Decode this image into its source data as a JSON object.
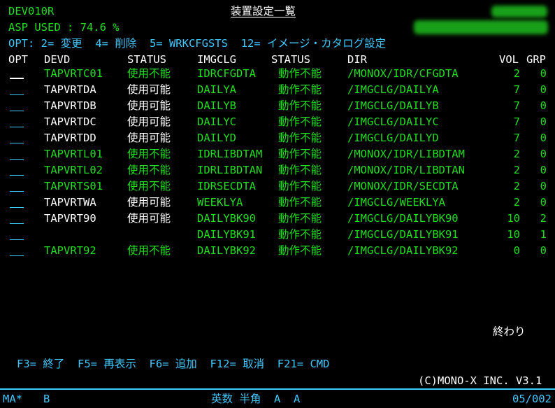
{
  "header": {
    "program_id": "DEV010R",
    "title": "装置設定一覧",
    "asp_used": "ASP USED : 74.6 %",
    "options": "OPT: 2= 変更  4= 削除  5= WRKCFGSTS  12= イメージ・カタログ設定"
  },
  "columns": {
    "opt": "OPT",
    "devd": "DEVD",
    "status": "STATUS",
    "imgclg": "IMGCLG",
    "status2": "STATUS",
    "dir": "DIR",
    "vol": "VOL",
    "grp": "GRP"
  },
  "rows": [
    {
      "devd": "TAPVRTC01",
      "status": "使用不能",
      "imgclg": "IDRCFGDTA",
      "status2": "動作不能",
      "dir": "/MONOX/IDR/CFGDTA",
      "vol": "2",
      "grp": "0",
      "devd_color": "#22dd22",
      "status_color": "#22dd22"
    },
    {
      "devd": "TAPVRTDA",
      "status": "使用可能",
      "imgclg": "DAILYA",
      "status2": "動作不能",
      "dir": "/IMGCLG/DAILYA",
      "vol": "7",
      "grp": "0",
      "devd_color": "#ffffff",
      "status_color": "#ffffff"
    },
    {
      "devd": "TAPVRTDB",
      "status": "使用可能",
      "imgclg": "DAILYB",
      "status2": "動作不能",
      "dir": "/IMGCLG/DAILYB",
      "vol": "7",
      "grp": "0",
      "devd_color": "#ffffff",
      "status_color": "#ffffff"
    },
    {
      "devd": "TAPVRTDC",
      "status": "使用可能",
      "imgclg": "DAILYC",
      "status2": "動作不能",
      "dir": "/IMGCLG/DAILYC",
      "vol": "7",
      "grp": "0",
      "devd_color": "#ffffff",
      "status_color": "#ffffff"
    },
    {
      "devd": "TAPVRTDD",
      "status": "使用可能",
      "imgclg": "DAILYD",
      "status2": "動作不能",
      "dir": "/IMGCLG/DAILYD",
      "vol": "7",
      "grp": "0",
      "devd_color": "#ffffff",
      "status_color": "#ffffff"
    },
    {
      "devd": "TAPVRTL01",
      "status": "使用不能",
      "imgclg": "IDRLIBDTAM",
      "status2": "動作不能",
      "dir": "/MONOX/IDR/LIBDTAM",
      "vol": "2",
      "grp": "0",
      "devd_color": "#22dd22",
      "status_color": "#22dd22"
    },
    {
      "devd": "TAPVRTL02",
      "status": "使用不能",
      "imgclg": "IDRLIBDTAN",
      "status2": "動作不能",
      "dir": "/MONOX/IDR/LIBDTAN",
      "vol": "2",
      "grp": "0",
      "devd_color": "#22dd22",
      "status_color": "#22dd22"
    },
    {
      "devd": "TAPVRTS01",
      "status": "使用不能",
      "imgclg": "IDRSECDTA",
      "status2": "動作不能",
      "dir": "/MONOX/IDR/SECDTA",
      "vol": "2",
      "grp": "0",
      "devd_color": "#22dd22",
      "status_color": "#22dd22"
    },
    {
      "devd": "TAPVRTWA",
      "status": "使用可能",
      "imgclg": "WEEKLYA",
      "status2": "動作不能",
      "dir": "/IMGCLG/WEEKLYA",
      "vol": "2",
      "grp": "0",
      "devd_color": "#ffffff",
      "status_color": "#ffffff"
    },
    {
      "devd": "TAPVRT90",
      "status": "使用可能",
      "imgclg": "DAILYBK90",
      "status2": "動作不能",
      "dir": "/IMGCLG/DAILYBK90",
      "vol": "10",
      "grp": "2",
      "devd_color": "#ffffff",
      "status_color": "#ffffff"
    },
    {
      "devd": "",
      "status": "",
      "imgclg": "DAILYBK91",
      "status2": "動作不能",
      "dir": "/IMGCLG/DAILYBK91",
      "vol": "10",
      "grp": "1",
      "devd_color": "#ffffff",
      "status_color": "#ffffff"
    },
    {
      "devd": "TAPVRT92",
      "status": "使用不能",
      "imgclg": "DAILYBK92",
      "status2": "動作不能",
      "dir": "/IMGCLG/DAILYBK92",
      "vol": "0",
      "grp": "0",
      "devd_color": "#22dd22",
      "status_color": "#22dd22"
    }
  ],
  "end_label": "終わり",
  "function_keys": "F3= 終了  F5= 再表示  F6= 追加  F12= 取消  F21= CMD",
  "copyright": "(C)MONO-X INC. V3.1",
  "statusbar": {
    "left": "MA*",
    "b": "B",
    "mode": "英数 半角  A  A",
    "page": "05/002"
  }
}
